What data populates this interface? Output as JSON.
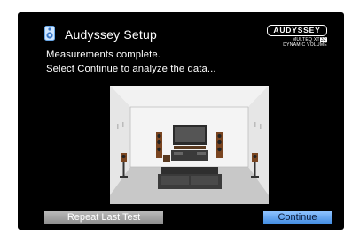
{
  "header": {
    "title": "Audyssey Setup",
    "icon": "speaker-icon"
  },
  "logo": {
    "brand": "AUDYSSEY",
    "line2_prefix": "MULTEQ XT",
    "line2_badge": "32",
    "line3": "DYNAMIC VOLUME"
  },
  "message": {
    "line1": "Measurements complete.",
    "line2": "Select Continue to analyze the data..."
  },
  "buttons": {
    "repeat_label": "Repeat Last Test",
    "continue_label": "Continue"
  },
  "colors": {
    "background": "#000000",
    "continue_button": "#5a9ff0",
    "repeat_button": "#a8a8a8",
    "room_floor": "#cfcfcf",
    "room_wall": "#eeeeee"
  }
}
